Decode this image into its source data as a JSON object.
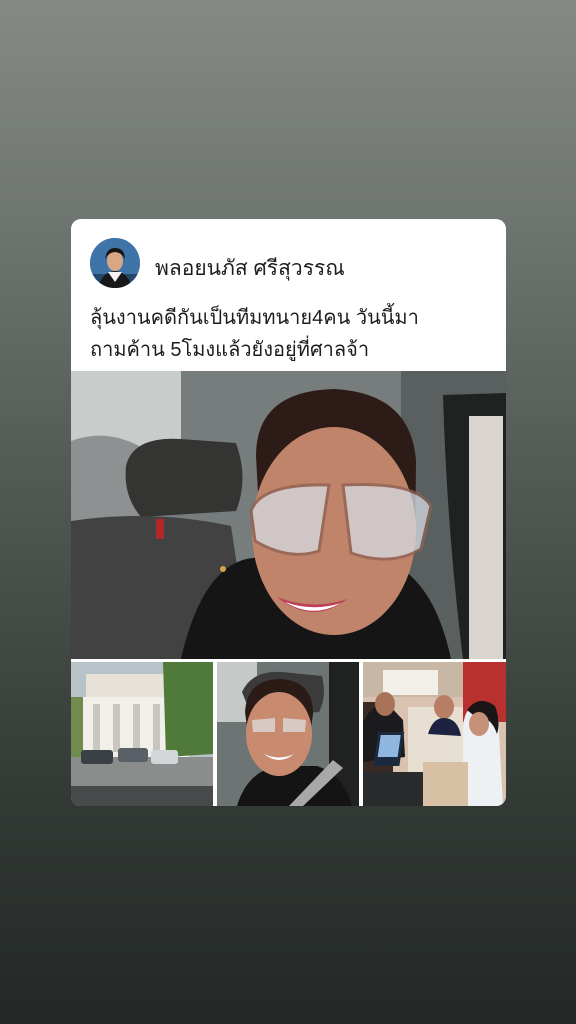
{
  "post": {
    "author_name": "พลอยนภัส ศรีสุวรรณ",
    "text_line_1": "ลุ้นงานคดีกันเป็นทีมทนาย4คน  วันนี้มา",
    "text_line_2": "ถามค้าน  5โมงแล้วยังอยู่ที่ศาลจ้า"
  },
  "photos": {
    "main": "car-selfie-photo",
    "thumbnails": [
      "court-building-photo",
      "car-selfie-photo",
      "office-meeting-photo"
    ]
  },
  "colors": {
    "card_background": "#ffffff",
    "text": "#1c1e21"
  }
}
